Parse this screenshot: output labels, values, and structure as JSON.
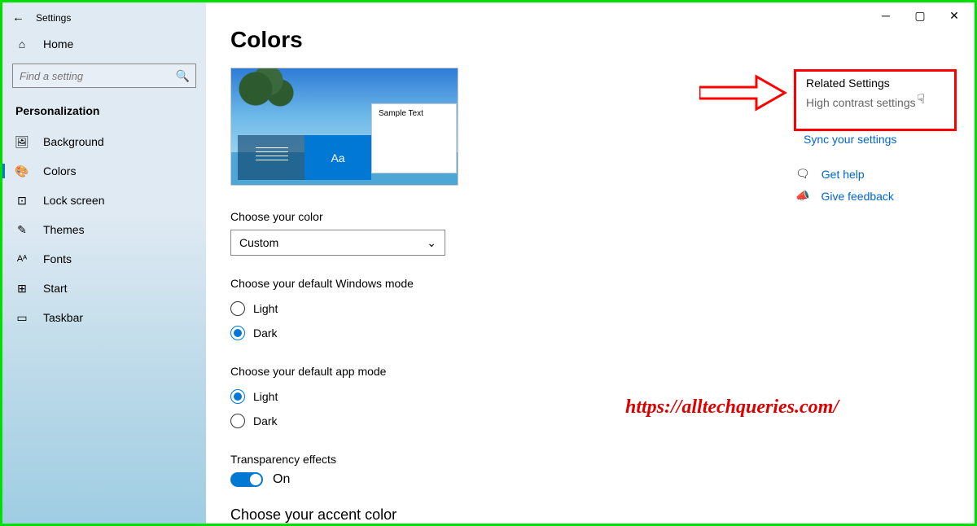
{
  "header": {
    "app_title": "Settings"
  },
  "sidebar": {
    "home": "Home",
    "search_placeholder": "Find a setting",
    "section": "Personalization",
    "items": [
      {
        "icon": "image",
        "label": "Background"
      },
      {
        "icon": "palette",
        "label": "Colors",
        "active": true
      },
      {
        "icon": "lock",
        "label": "Lock screen"
      },
      {
        "icon": "edit",
        "label": "Themes"
      },
      {
        "icon": "font",
        "label": "Fonts"
      },
      {
        "icon": "grid",
        "label": "Start"
      },
      {
        "icon": "taskbar",
        "label": "Taskbar"
      }
    ]
  },
  "page": {
    "title": "Colors",
    "preview_sample": "Sample Text",
    "preview_aa": "Aa",
    "choose_color_label": "Choose your color",
    "color_dropdown": "Custom",
    "windows_mode_label": "Choose your default Windows mode",
    "windows_mode_options": {
      "light": "Light",
      "dark": "Dark"
    },
    "windows_mode_selected": "dark",
    "app_mode_label": "Choose your default app mode",
    "app_mode_options": {
      "light": "Light",
      "dark": "Dark"
    },
    "app_mode_selected": "light",
    "transparency_label": "Transparency effects",
    "transparency_state": "On",
    "accent_header": "Choose your accent color"
  },
  "related": {
    "title": "Related Settings",
    "link1": "High contrast settings",
    "link2": "Sync your settings"
  },
  "help": {
    "get_help": "Get help",
    "feedback": "Give feedback"
  },
  "watermark": "https://alltechqueries.com/"
}
